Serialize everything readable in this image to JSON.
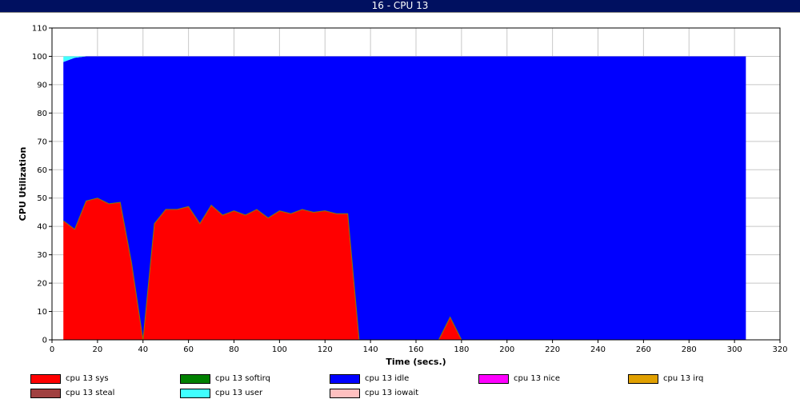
{
  "window": {
    "title": "16 - CPU 13"
  },
  "chart_data": {
    "type": "area",
    "title": "",
    "xlabel": "Time (secs.)",
    "ylabel": "CPU Utilization",
    "xlim": [
      0,
      320
    ],
    "ylim": [
      0,
      110
    ],
    "xticks": [
      0,
      20,
      40,
      60,
      80,
      100,
      120,
      140,
      160,
      180,
      200,
      220,
      240,
      260,
      280,
      300,
      320
    ],
    "yticks": [
      0,
      10,
      20,
      30,
      40,
      50,
      60,
      70,
      80,
      90,
      100,
      110
    ],
    "grid": true,
    "legend_position": "bottom",
    "x": [
      5,
      10,
      15,
      20,
      25,
      30,
      35,
      40,
      45,
      50,
      55,
      60,
      65,
      70,
      75,
      80,
      85,
      90,
      95,
      100,
      105,
      110,
      115,
      120,
      125,
      130,
      135,
      140,
      145,
      150,
      155,
      160,
      165,
      170,
      175,
      180,
      185,
      190,
      195,
      200,
      205,
      210,
      215,
      220,
      225,
      230,
      235,
      240,
      245,
      250,
      255,
      260,
      265,
      270,
      275,
      280,
      285,
      290,
      295,
      300,
      305
    ],
    "series": [
      {
        "name": "cpu 13 sys",
        "color": "#ff0000",
        "values": [
          42,
          39,
          49,
          50,
          48,
          48.5,
          27,
          0,
          41,
          46,
          46,
          47,
          41,
          47.5,
          44,
          45.5,
          44,
          46,
          43,
          45.5,
          44.5,
          46,
          45,
          45.5,
          44.5,
          44.5,
          0,
          0,
          0,
          0,
          0,
          0,
          0,
          0,
          8,
          0,
          0,
          0,
          0,
          0,
          0,
          0,
          0,
          0,
          0,
          0,
          0,
          0,
          0,
          0,
          0,
          0,
          0,
          0,
          0,
          0,
          0,
          0,
          0,
          0,
          0
        ]
      },
      {
        "name": "cpu 13 softirq",
        "color": "#008000",
        "values": [
          0,
          0,
          0,
          0,
          0,
          0,
          0,
          0,
          0,
          0,
          0,
          0,
          0,
          0,
          0,
          0,
          0,
          0,
          0,
          0,
          0,
          0,
          0,
          0,
          0,
          0,
          0,
          0,
          0,
          0,
          0,
          0,
          0,
          0,
          0,
          0,
          0,
          0,
          0,
          0,
          0,
          0,
          0,
          0,
          0,
          0,
          0,
          0,
          0,
          0,
          0,
          0,
          0,
          0,
          0,
          0,
          0,
          0,
          0,
          0,
          0
        ]
      },
      {
        "name": "cpu 13 idle",
        "color": "#0000ff",
        "values": [
          56,
          60.5,
          51,
          50,
          52,
          51.5,
          73,
          100,
          59,
          54,
          54,
          53,
          59,
          52.5,
          56,
          54.5,
          56,
          54,
          57,
          54.5,
          55.5,
          54,
          55,
          54.5,
          55.5,
          55.5,
          100,
          100,
          100,
          100,
          100,
          100,
          100,
          100,
          92,
          100,
          100,
          100,
          100,
          100,
          100,
          100,
          100,
          100,
          100,
          100,
          100,
          100,
          100,
          100,
          100,
          100,
          100,
          100,
          100,
          100,
          100,
          100,
          100,
          100,
          100
        ]
      },
      {
        "name": "cpu 13 nice",
        "color": "#ff00ff",
        "values": [
          0,
          0,
          0,
          0,
          0,
          0,
          0,
          0,
          0,
          0,
          0,
          0,
          0,
          0,
          0,
          0,
          0,
          0,
          0,
          0,
          0,
          0,
          0,
          0,
          0,
          0,
          0,
          0,
          0,
          0,
          0,
          0,
          0,
          0,
          0,
          0,
          0,
          0,
          0,
          0,
          0,
          0,
          0,
          0,
          0,
          0,
          0,
          0,
          0,
          0,
          0,
          0,
          0,
          0,
          0,
          0,
          0,
          0,
          0,
          0,
          0
        ]
      },
      {
        "name": "cpu 13 irq",
        "color": "#e0a000",
        "values": [
          0,
          0,
          0,
          0,
          0,
          0,
          0,
          0,
          0,
          0,
          0,
          0,
          0,
          0,
          0,
          0,
          0,
          0,
          0,
          0,
          0,
          0,
          0,
          0,
          0,
          0,
          0,
          0,
          0,
          0,
          0,
          0,
          0,
          0,
          0,
          0,
          0,
          0,
          0,
          0,
          0,
          0,
          0,
          0,
          0,
          0,
          0,
          0,
          0,
          0,
          0,
          0,
          0,
          0,
          0,
          0,
          0,
          0,
          0,
          0,
          0
        ]
      },
      {
        "name": "cpu 13 steal",
        "color": "#a04040",
        "values": [
          0,
          0,
          0,
          0,
          0,
          0,
          0,
          0,
          0,
          0,
          0,
          0,
          0,
          0,
          0,
          0,
          0,
          0,
          0,
          0,
          0,
          0,
          0,
          0,
          0,
          0,
          0,
          0,
          0,
          0,
          0,
          0,
          0,
          0,
          0,
          0,
          0,
          0,
          0,
          0,
          0,
          0,
          0,
          0,
          0,
          0,
          0,
          0,
          0,
          0,
          0,
          0,
          0,
          0,
          0,
          0,
          0,
          0,
          0,
          0,
          0
        ]
      },
      {
        "name": "cpu 13 user",
        "color": "#40ffff",
        "values": [
          2,
          0.5,
          0,
          0,
          0,
          0,
          0,
          0,
          0,
          0,
          0,
          0,
          0,
          0,
          0,
          0,
          0,
          0,
          0,
          0,
          0,
          0,
          0,
          0,
          0,
          0,
          0,
          0,
          0,
          0,
          0,
          0,
          0,
          0,
          0,
          0,
          0,
          0,
          0,
          0,
          0,
          0,
          0,
          0,
          0,
          0,
          0,
          0,
          0,
          0,
          0,
          0,
          0,
          0,
          0,
          0,
          0,
          0,
          0,
          0,
          0
        ]
      },
      {
        "name": "cpu 13 iowait",
        "color": "#ffc0c0",
        "values": [
          0,
          0,
          0,
          0,
          0,
          0,
          0,
          0,
          0,
          0,
          0,
          0,
          0,
          0,
          0,
          0,
          0,
          0,
          0,
          0,
          0,
          0,
          0,
          0,
          0,
          0,
          0,
          0,
          0,
          0,
          0,
          0,
          0,
          0,
          0,
          0,
          0,
          0,
          0,
          0,
          0,
          0,
          0,
          0,
          0,
          0,
          0,
          0,
          0,
          0,
          0,
          0,
          0,
          0,
          0,
          0,
          0,
          0,
          0,
          0,
          0
        ]
      }
    ]
  }
}
